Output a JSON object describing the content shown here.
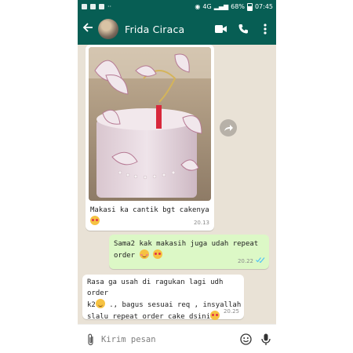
{
  "status_bar": {
    "network": "4G",
    "battery": "68%",
    "time": "07:45"
  },
  "header": {
    "back_icon": "arrow-left-icon",
    "contact_name": "Frida Ciraca",
    "icons": [
      "video-call-icon",
      "phone-call-icon",
      "more-vert-icon"
    ]
  },
  "messages": [
    {
      "direction": "incoming",
      "has_image": true,
      "image_subject": "pink birthday cake with butterfly toppers",
      "text": "Makasi ka cantik bgt cakenya",
      "emoji": [
        "heart-eyes"
      ],
      "time": "20.13"
    },
    {
      "direction": "outgoing",
      "line1": "Sama2 kak makasih juga udah repeat",
      "line2": "order",
      "emoji": [
        "blush",
        "heart-eyes"
      ],
      "time": "20.22",
      "read_receipt": "double-check-blue"
    },
    {
      "direction": "incoming",
      "line1": "Rasa ga usah di ragukan lagi udh order",
      "line2a": "k2",
      "line2b": " ., bagus sesuai req , insyallah",
      "line3": "slalu repeat order cake dsini",
      "emoji": [
        "grin",
        "heart-eyes"
      ],
      "time": "20.25"
    }
  ],
  "input": {
    "placeholder": "Kirim pesan"
  },
  "colors": {
    "header": "#075e54",
    "chat_background": "#e9e2d6",
    "outgoing_bubble": "#dcf8c6",
    "read_tick": "#4fc3f7"
  }
}
